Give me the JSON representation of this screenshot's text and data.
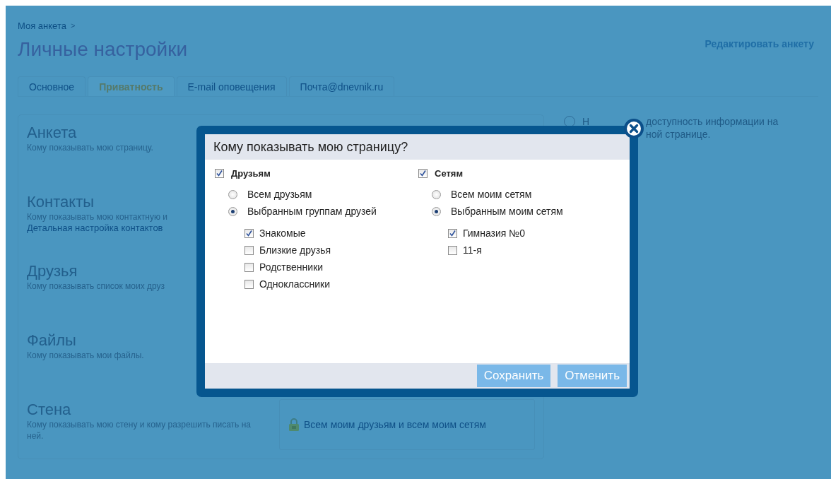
{
  "breadcrumb": {
    "link": "Моя анкета",
    "separator": ">"
  },
  "title": "Личные настройки",
  "edit_link": "Редактировать анкету",
  "tabs": [
    {
      "label": "Основное",
      "selected": false
    },
    {
      "label": "Приватность",
      "selected": true
    },
    {
      "label": "E-mail оповещения",
      "selected": false
    },
    {
      "label": "Почта@dnevnik.ru",
      "selected": false
    }
  ],
  "sections": [
    {
      "title": "Анкета",
      "description": "Кому показывать мою страницу."
    },
    {
      "title": "Контакты",
      "description": "Кому показывать мою контактную и",
      "link": "Детальная настройка контактов"
    },
    {
      "title": "Друзья",
      "description": "Кому показывать список моих друз"
    },
    {
      "title": "Файлы",
      "description": "Кому показывать мои файлы."
    },
    {
      "title": "Стена",
      "description": "Кому показывать мою стену и кому разрешить писать на ней.",
      "setting": "Всем моим друзьям и всем моим сетям"
    }
  ],
  "side_note": {
    "selected": false,
    "prefix": "Н",
    "lines": [
      "доступность информации на",
      "ной странице."
    ]
  },
  "modal": {
    "title": "Кому показывать мою страницу?",
    "groups": [
      {
        "label": "Друзьям",
        "checked": true,
        "options": [
          {
            "label": "Всем друзьям",
            "selected": false
          },
          {
            "label": "Выбранным группам друзей",
            "selected": true
          }
        ],
        "items": [
          {
            "label": "Знакомые",
            "checked": true
          },
          {
            "label": "Близкие друзья",
            "checked": false
          },
          {
            "label": "Родственники",
            "checked": false
          },
          {
            "label": "Одноклассники",
            "checked": false
          }
        ]
      },
      {
        "label": "Сетям",
        "checked": true,
        "options": [
          {
            "label": "Всем моим сетям",
            "selected": false
          },
          {
            "label": "Выбранным моим сетям",
            "selected": true
          }
        ],
        "items": [
          {
            "label": "Гимназия №0",
            "checked": true
          },
          {
            "label": "11-я",
            "checked": false
          }
        ]
      }
    ],
    "buttons": [
      "Сохранить",
      "Отменить"
    ]
  }
}
